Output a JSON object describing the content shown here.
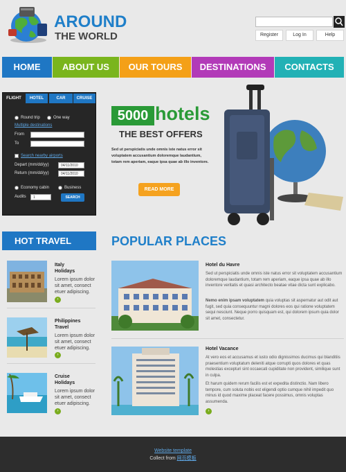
{
  "header": {
    "logo_line1": "AROUND",
    "logo_line2": "THE WORLD",
    "links": [
      "Register",
      "Log In",
      "Help"
    ]
  },
  "nav": {
    "items": [
      {
        "label": "HOME",
        "color": "#1f77c4"
      },
      {
        "label": "ABOUT US",
        "color": "#7ab51d"
      },
      {
        "label": "OUR TOURS",
        "color": "#f4a017"
      },
      {
        "label": "DESTINATIONS",
        "color": "#b23ab8"
      },
      {
        "label": "CONTACTS",
        "color": "#22b1b5"
      }
    ]
  },
  "search_widget": {
    "tabs": [
      "FLIGHT",
      "HOTEL",
      "CAR",
      "CRUISE"
    ],
    "round_trip": "Round trip",
    "one_way": "One way",
    "multiple_destinations": "Multiple destinations",
    "from_label": "From",
    "to_label": "To",
    "search_nearby": "Search nearby airports",
    "depart_label": "Depart (mm/dd/yy)",
    "depart_value": "04/11/2010",
    "return_label": "Return (mm/dd/yy)",
    "return_value": "04/11/2010",
    "economy": "Economy cabin",
    "business": "Business",
    "adults_label": "Audits",
    "adults_value": "1",
    "search_button": "SEARCH"
  },
  "promo": {
    "badge": "5000",
    "hotels": "hotels",
    "subtitle": "THE BEST OFFERS",
    "text": "Sed ut perspiciatis unde omnis iste natus error sit voluptatem accusantium doloremque laudantium, totam rem aperiam, eaque ipsa quae ab illo inventore.",
    "read_more": "READ MORE"
  },
  "hot_travel": {
    "header": "HOT TRAVEL",
    "items": [
      {
        "title1": "Italy",
        "title2": "Holidays",
        "text1": "Lorem ipsum dolor",
        "text2": "sit amet, consect",
        "text3": "etuer adipiscing."
      },
      {
        "title1": "Philippines",
        "title2": "Travel",
        "text1": "Lorem ipsum dolor",
        "text2": "sit amet, consect",
        "text3": "etuer adipiscing."
      },
      {
        "title1": "Cruise",
        "title2": "Holidays",
        "text1": "Lorem ipsum dolor",
        "text2": "sit amet, consect",
        "text3": "etuer adipiscing."
      }
    ]
  },
  "popular_places": {
    "header": "POPULAR PLACES",
    "places": [
      {
        "title": "Hotel du Havre",
        "para1": "Sed ut perspiciatis unde omnis iste natus error sit voluptatem accusantium doloremque laudantium, totam rem aperiam, eaque ipsa quae ab illo inventore veritatis et quasi architecto beatae vitae dicta sunt explicabo.",
        "para2_bold": "Nemo enim ipsam voluptatem",
        "para2": " quia voluptas sit aspernatur aut odit aut fugit, sed quia consequuntur magni dolores eos qui ratione voluptatem sequi nesciunt. Neque porro quisquam est, qui dolorem ipsum quia dolor sit amet, consectetur."
      },
      {
        "title": "Hotel Vacance",
        "para1": "At vero eos et accusamus et iusto odio dignissimos ducimus qui blanditiis praesentium voluptatum deleniti atque corrupti quos dolores et quas molestias excepturi sint occaecati cupiditate non provident, similique sunt in culpa.",
        "para2": "Et harum quidem rerum facilis est et expedita distinctio. Nam libero tempore, cum soluta nobis est eligendi optio cumque nihil impedit quo minus id quod maxime placeat facere possimus, omnis voluptas assumenda."
      }
    ]
  },
  "footer": {
    "link1": "Website template",
    "collect_prefix": "Collect from ",
    "link2": "网页模板"
  }
}
